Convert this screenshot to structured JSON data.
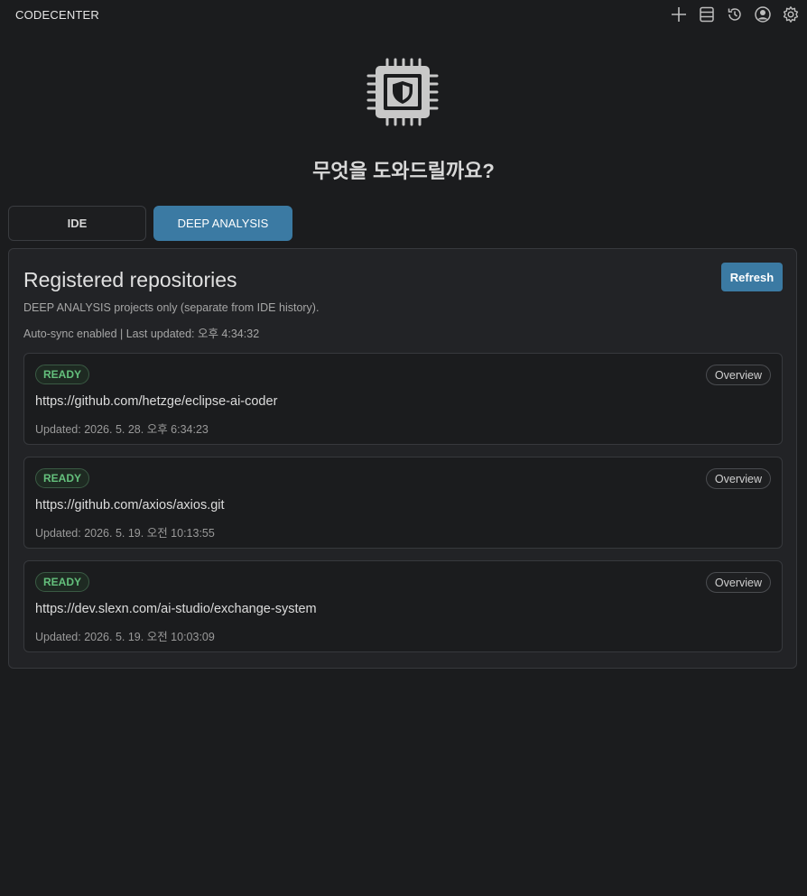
{
  "app": {
    "title": "CODECENTER"
  },
  "toolbar": {
    "icons": [
      "plus-icon",
      "database-icon",
      "history-icon",
      "account-icon",
      "gear-icon"
    ]
  },
  "hero": {
    "title": "무엇을 도와드릴까요?",
    "icon": "chip-shield-icon"
  },
  "tabs": [
    {
      "label": "IDE",
      "active": false
    },
    {
      "label": "DEEP ANALYSIS",
      "active": true
    }
  ],
  "panel": {
    "title": "Registered repositories",
    "refresh_label": "Refresh",
    "subtitle": "DEEP ANALYSIS projects only (separate from IDE history).",
    "sync_status": "Auto-sync enabled | Last updated: 오후 4:34:32"
  },
  "repos": [
    {
      "status": "READY",
      "overview_label": "Overview",
      "url": "https://github.com/hetzge/eclipse-ai-coder",
      "updated": "Updated: 2026. 5. 28. 오후 6:34:23"
    },
    {
      "status": "READY",
      "overview_label": "Overview",
      "url": "https://github.com/axios/axios.git",
      "updated": "Updated: 2026. 5. 19. 오전 10:13:55"
    },
    {
      "status": "READY",
      "overview_label": "Overview",
      "url": "https://dev.slexn.com/ai-studio/exchange-system",
      "updated": "Updated: 2026. 5. 19. 오전 10:03:09"
    }
  ],
  "colors": {
    "background": "#1b1c1e",
    "accent": "#3b7aa3",
    "ready_green": "#64c07c"
  }
}
